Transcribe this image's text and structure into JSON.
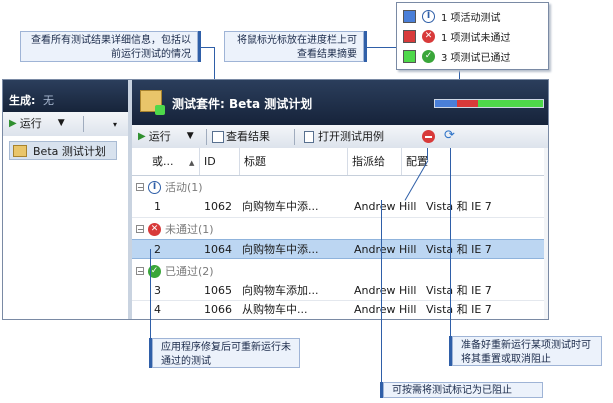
{
  "callouts": {
    "details": "查看所有测试结果详细信息，包括以前运行测试的情况",
    "progress": "将鼠标光标放在进度栏上可查看结果摘要",
    "fix_rerun": "应用程序修复后可重新运行未通过的测试",
    "reset_unblock": "准备好重新运行某项测试时可将其重置或取消阻止",
    "mark_blocked": "可按需将测试标记为已阻止"
  },
  "legend": {
    "items": [
      {
        "label": "1 项活动测试",
        "color": "#4a7fd8"
      },
      {
        "label": "1 项测试未通过",
        "color": "#d83a3a"
      },
      {
        "label": "3 项测试已通过",
        "color": "#4ed84a"
      }
    ]
  },
  "left_panel": {
    "build_label": "生成:",
    "build_value": "无",
    "run_label": "运行",
    "plan_item": "Beta 测试计划"
  },
  "header": {
    "title": "测试套件:  Beta 测试计划"
  },
  "progress_bar": {
    "active": 0.2,
    "failed": 0.2,
    "passed": 0.6
  },
  "toolbar": {
    "run_label": "运行",
    "view_results_label": "查看结果",
    "open_case_label": "打开测试用例"
  },
  "columns": [
    "或...",
    "ID",
    "标题",
    "指派给",
    "配置"
  ],
  "groups": [
    {
      "label": "活动(1)",
      "rows": [
        {
          "order": "1",
          "id": "1062",
          "title": "向购物车中添...",
          "assigned": "Andrew Hill",
          "config": "Vista 和 IE 7"
        }
      ]
    },
    {
      "label": "未通过(1)",
      "rows": [
        {
          "order": "2",
          "id": "1064",
          "title": "向购物车中添...",
          "assigned": "Andrew Hill",
          "config": "Vista 和 IE 7"
        }
      ]
    },
    {
      "label": "已通过(2)",
      "rows": [
        {
          "order": "3",
          "id": "1065",
          "title": "向购物车添加...",
          "assigned": "Andrew Hill",
          "config": "Vista 和 IE 7"
        },
        {
          "order": "4",
          "id": "1066",
          "title": "从购物车中...",
          "assigned": "Andrew Hill",
          "config": "Vista 和 IE 7"
        }
      ]
    }
  ]
}
